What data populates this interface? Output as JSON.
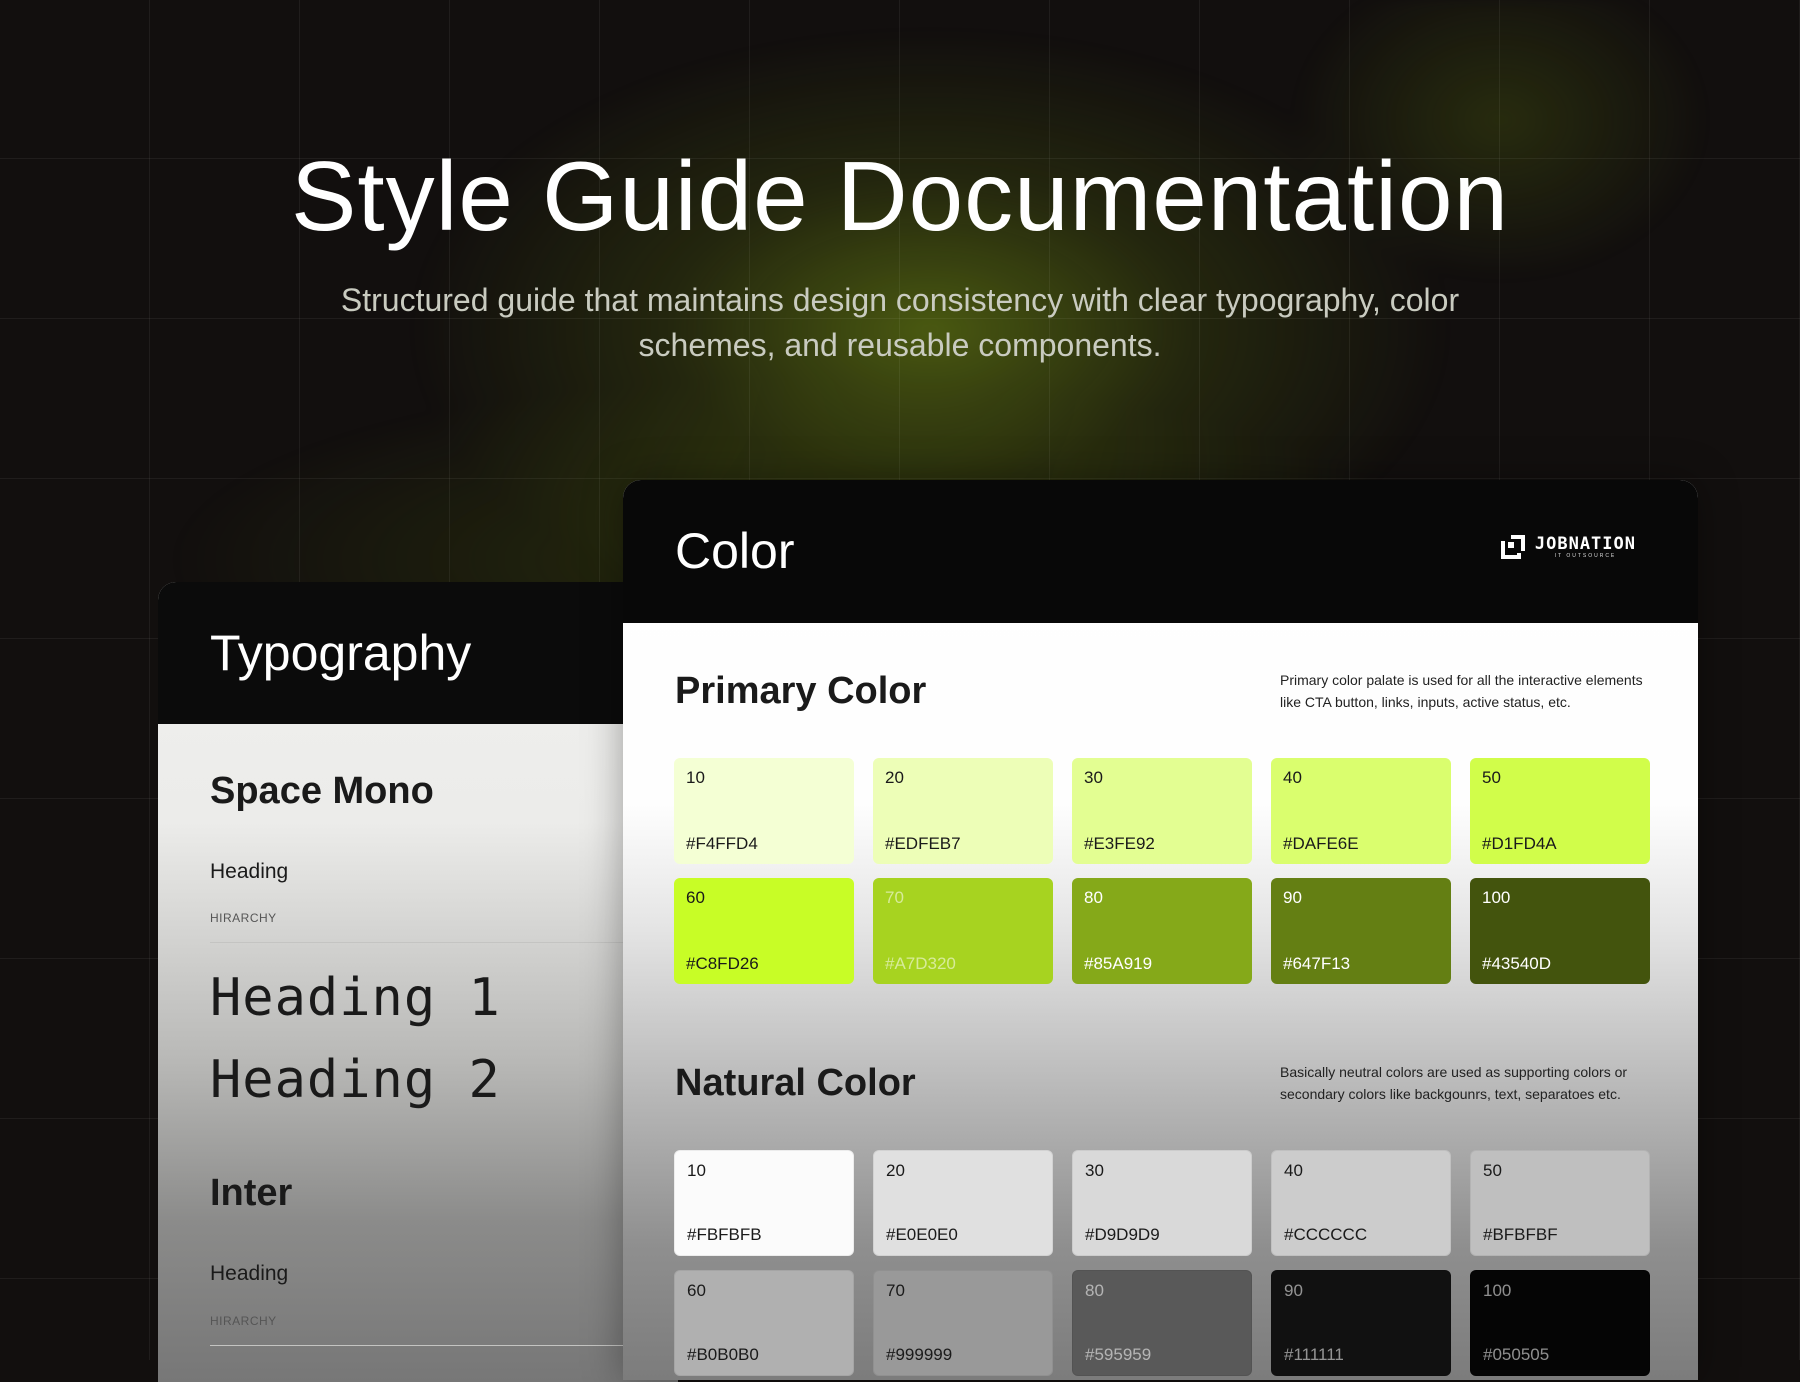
{
  "hero": {
    "title": "Style Guide Documentation",
    "subtitle": "Structured guide that maintains design consistency with clear typography, color schemes, and reusable components."
  },
  "typography": {
    "title": "Typography",
    "font1": {
      "name": "Space Mono",
      "sub": "Heading",
      "label": "HIRARCHY",
      "samples": [
        "Heading 1",
        "Heading 2"
      ]
    },
    "font2": {
      "name": "Inter",
      "sub": "Heading",
      "label": "HIRARCHY"
    }
  },
  "color": {
    "title": "Color",
    "logo": {
      "name": "JOBNATION",
      "tagline": "IT OUTSOURCE",
      "icon": "jobnation-logo-icon"
    },
    "primary": {
      "title": "Primary Color",
      "description": "Primary color palate is used for all the interactive elements like CTA button, links, inputs, active status, etc.",
      "swatches": [
        {
          "step": "10",
          "hex": "#F4FFD4",
          "color": "#F4FFD4",
          "text": "dark"
        },
        {
          "step": "20",
          "hex": "#EDFEB7",
          "color": "#EDFEB7",
          "text": "dark"
        },
        {
          "step": "30",
          "hex": "#E3FE92",
          "color": "#E3FE92",
          "text": "dark"
        },
        {
          "step": "40",
          "hex": "#DAFE6E",
          "color": "#DAFE6E",
          "text": "dark"
        },
        {
          "step": "50",
          "hex": "#D1FD4A",
          "color": "#D1FD4A",
          "text": "dark"
        },
        {
          "step": "60",
          "hex": "#C8FD26",
          "color": "#C8FD26",
          "text": "dark"
        },
        {
          "step": "70",
          "hex": "#A7D320",
          "color": "#A7D320",
          "text": "soft"
        },
        {
          "step": "80",
          "hex": "#85A919",
          "color": "#85A919",
          "text": "light"
        },
        {
          "step": "90",
          "hex": "#647F13",
          "color": "#647F13",
          "text": "light"
        },
        {
          "step": "100",
          "hex": "#43540D",
          "color": "#43540D",
          "text": "light"
        }
      ]
    },
    "natural": {
      "title": "Natural Color",
      "description": "Basically neutral colors are used as supporting colors or secondary colors like backgounrs, text, separatoes etc.",
      "swatches": [
        {
          "step": "10",
          "hex": "#FBFBFB",
          "color": "#FBFBFB",
          "text": "dark"
        },
        {
          "step": "20",
          "hex": "#E0E0E0",
          "color": "#E0E0E0",
          "text": "dark"
        },
        {
          "step": "30",
          "hex": "#D9D9D9",
          "color": "#D9D9D9",
          "text": "dark"
        },
        {
          "step": "40",
          "hex": "#CCCCCC",
          "color": "#CCCCCC",
          "text": "dark"
        },
        {
          "step": "50",
          "hex": "#BFBFBF",
          "color": "#BFBFBF",
          "text": "dark"
        },
        {
          "step": "60",
          "hex": "#B0B0B0",
          "color": "#B0B0B0",
          "text": "dark"
        },
        {
          "step": "70",
          "hex": "#999999",
          "color": "#999999",
          "text": "dark"
        },
        {
          "step": "80",
          "hex": "#595959",
          "color": "#595959",
          "text": "soft"
        },
        {
          "step": "90",
          "hex": "#111111",
          "color": "#111111",
          "text": "soft"
        },
        {
          "step": "100",
          "hex": "#050505",
          "color": "#050505",
          "text": "soft"
        }
      ]
    }
  }
}
